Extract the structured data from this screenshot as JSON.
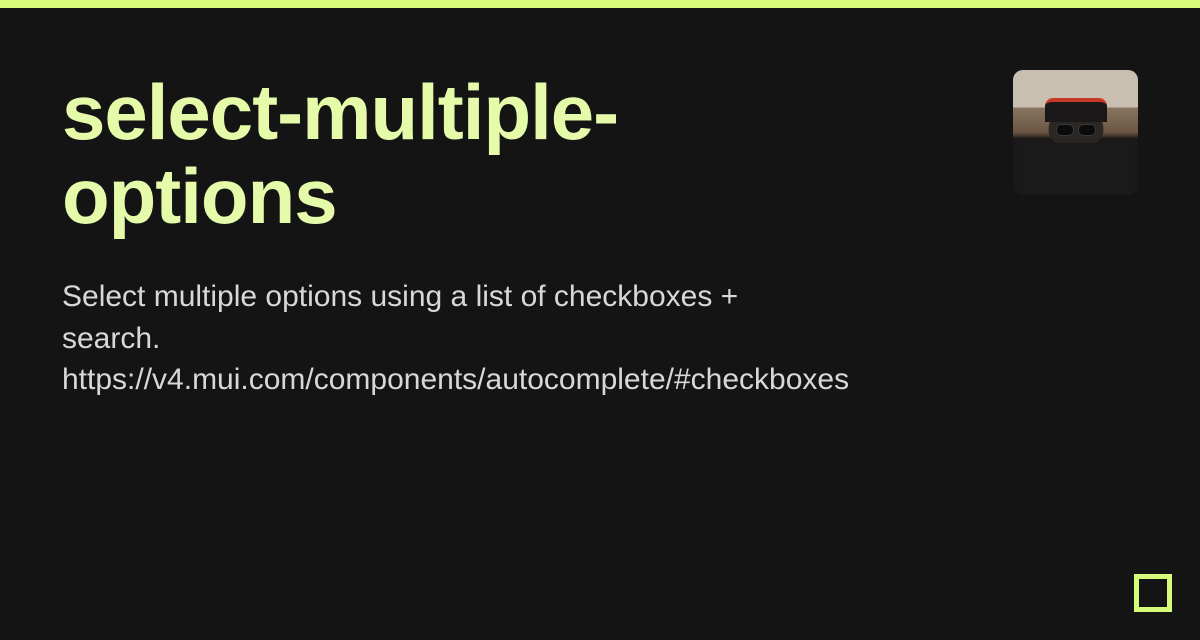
{
  "colors": {
    "accent": "#d6fb78",
    "title": "#e5fba9",
    "background": "#141414",
    "text": "#d8d8d8"
  },
  "card": {
    "title": "select-multiple-options",
    "description": "Select multiple options using a list of checkboxes + search. https://v4.mui.com/components/autocomplete/#checkboxes"
  }
}
